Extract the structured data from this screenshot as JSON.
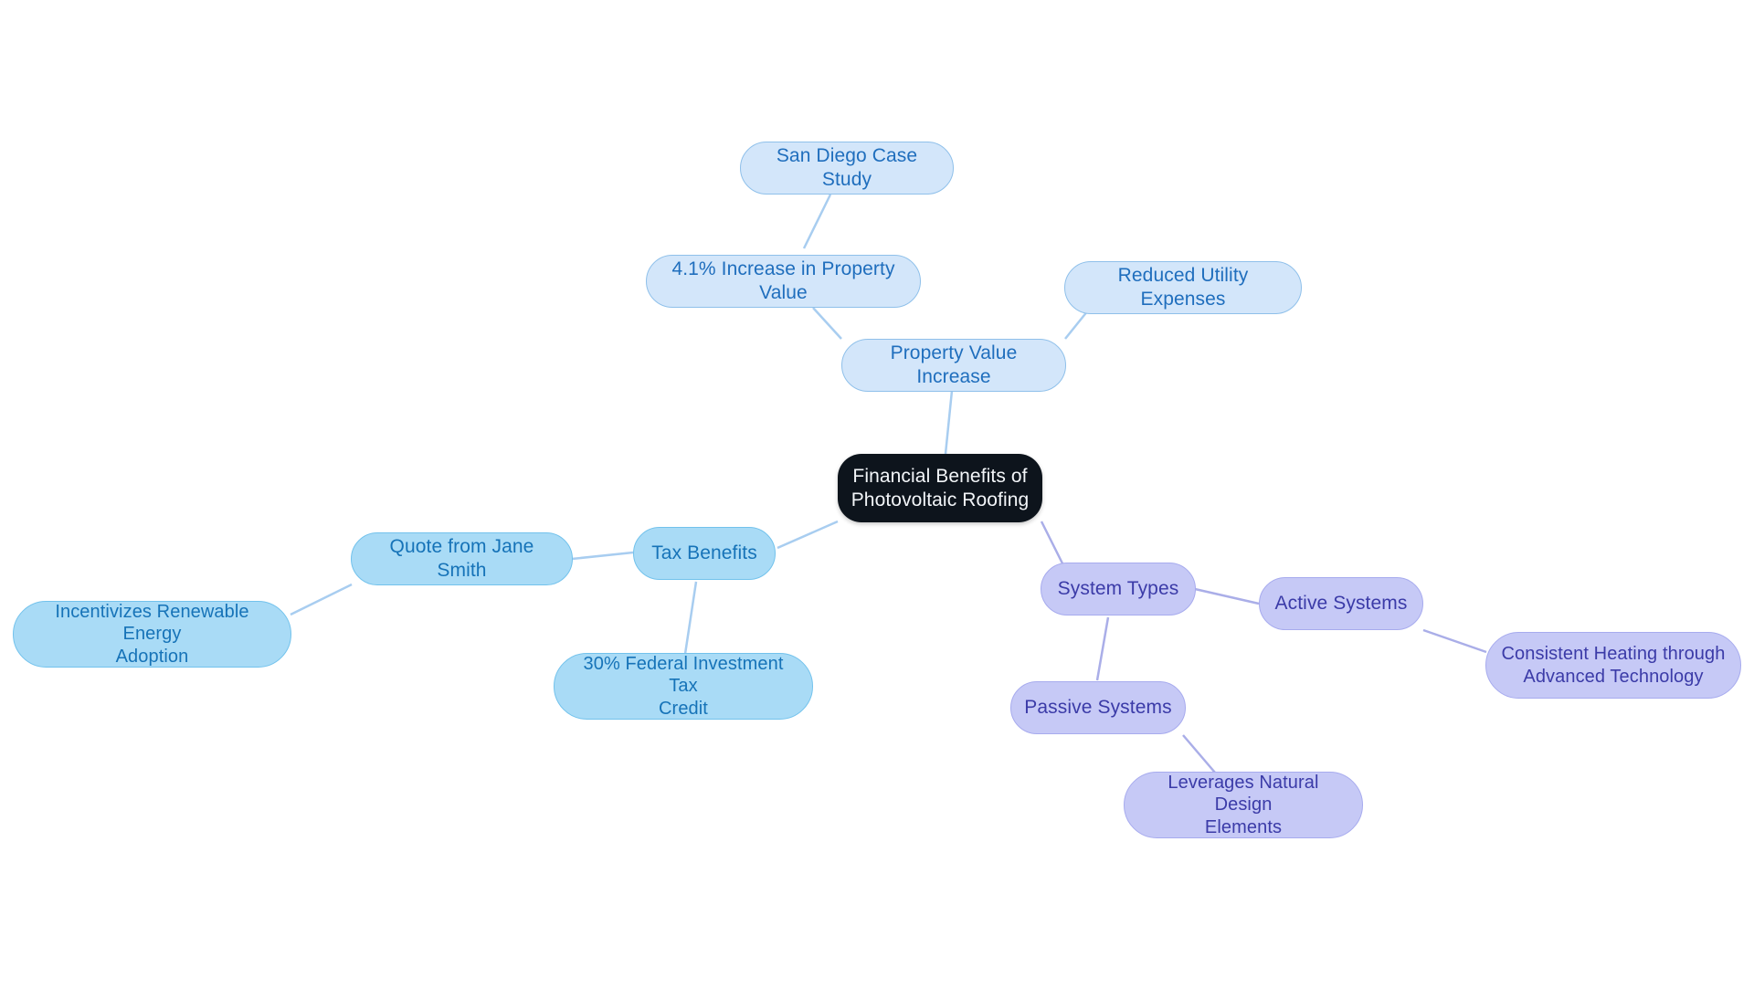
{
  "diagram": {
    "type": "mind-map",
    "title": "Financial Benefits of Photovoltaic Roofing",
    "background_color": "#ffffff",
    "palette": {
      "root_fill": "#0d141c",
      "root_text": "#f2f5f8",
      "blue_pale_fill": "#d3e6fa",
      "blue_pale_border": "#8fc0ea",
      "blue_pale_text": "#1f6ebd",
      "blue_fill": "#a9dbf6",
      "blue_border": "#72c2ec",
      "blue_text": "#1673b8",
      "purple_fill": "#c6c9f6",
      "purple_border": "#a7abee",
      "purple_text": "#3b3ba8",
      "edge_blue": "#a8cdf0",
      "edge_purple": "#aaaee8"
    }
  },
  "nodes": {
    "root": {
      "label": "Financial Benefits of\nPhotovoltaic Roofing"
    },
    "property_value_increase": {
      "label": "Property Value Increase"
    },
    "reduced_utility_expenses": {
      "label": "Reduced Utility Expenses"
    },
    "increase_in_property_value": {
      "label": "4.1% Increase in Property Value"
    },
    "san_diego_case_study": {
      "label": "San Diego Case Study"
    },
    "tax_benefits": {
      "label": "Tax Benefits"
    },
    "quote_from_jane_smith": {
      "label": "Quote from Jane Smith"
    },
    "incentivizes_renewable_energy": {
      "label": "Incentivizes Renewable Energy\nAdoption"
    },
    "federal_investment_tax_credit": {
      "label": "30% Federal Investment Tax\nCredit"
    },
    "system_types": {
      "label": "System Types"
    },
    "active_systems": {
      "label": "Active Systems"
    },
    "consistent_heating": {
      "label": "Consistent Heating through\nAdvanced Technology"
    },
    "passive_systems": {
      "label": "Passive Systems"
    },
    "leverages_natural_design": {
      "label": "Leverages Natural Design\nElements"
    }
  },
  "edges": [
    {
      "from": "root",
      "to": "property_value_increase",
      "color": "#a8cdf0"
    },
    {
      "from": "property_value_increase",
      "to": "reduced_utility_expenses",
      "color": "#a8cdf0"
    },
    {
      "from": "property_value_increase",
      "to": "increase_in_property_value",
      "color": "#a8cdf0"
    },
    {
      "from": "increase_in_property_value",
      "to": "san_diego_case_study",
      "color": "#a8cdf0"
    },
    {
      "from": "root",
      "to": "tax_benefits",
      "color": "#a8cdf0"
    },
    {
      "from": "tax_benefits",
      "to": "quote_from_jane_smith",
      "color": "#a8cdf0"
    },
    {
      "from": "quote_from_jane_smith",
      "to": "incentivizes_renewable_energy",
      "color": "#a8cdf0"
    },
    {
      "from": "tax_benefits",
      "to": "federal_investment_tax_credit",
      "color": "#a8cdf0"
    },
    {
      "from": "root",
      "to": "system_types",
      "color": "#aaaee8"
    },
    {
      "from": "system_types",
      "to": "active_systems",
      "color": "#aaaee8"
    },
    {
      "from": "active_systems",
      "to": "consistent_heating",
      "color": "#aaaee8"
    },
    {
      "from": "system_types",
      "to": "passive_systems",
      "color": "#aaaee8"
    },
    {
      "from": "passive_systems",
      "to": "leverages_natural_design",
      "color": "#aaaee8"
    }
  ]
}
